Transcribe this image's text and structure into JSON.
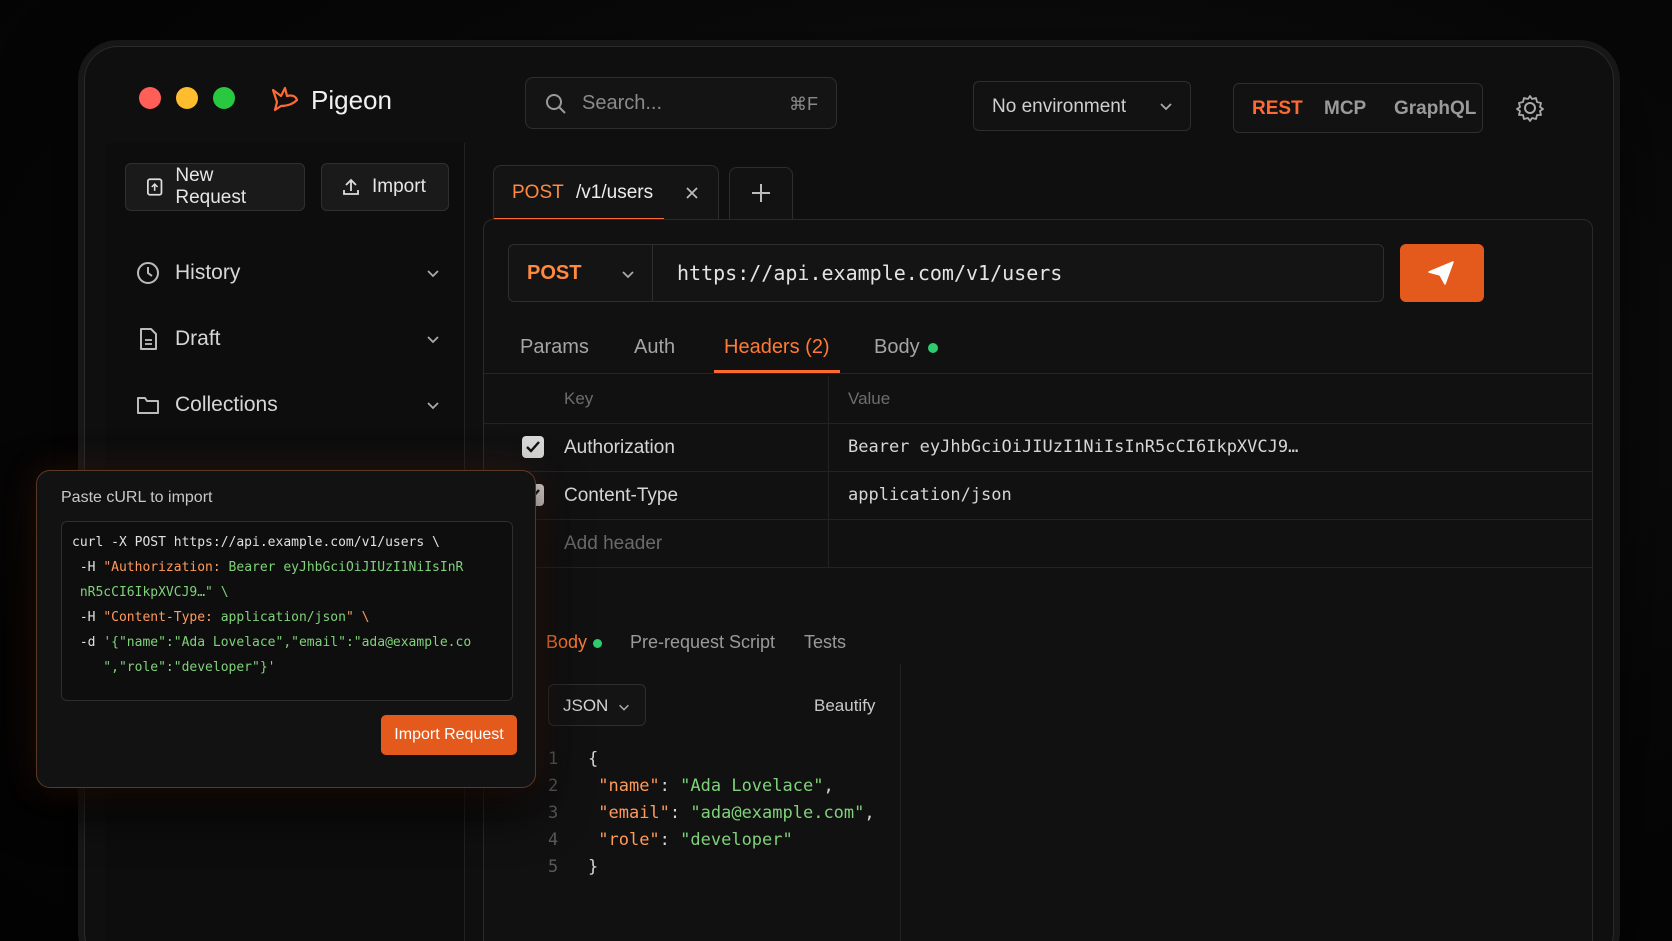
{
  "app": {
    "title": "Pigeon"
  },
  "search": {
    "placeholder": "Search...",
    "shortcut": "⌘F"
  },
  "environment": {
    "selected": "No environment"
  },
  "protocols": [
    "REST",
    "MCP",
    "GraphQL"
  ],
  "sidebar": {
    "new_request": "New Request",
    "import": "Import",
    "items": [
      {
        "label": "History",
        "icon": "clock-icon"
      },
      {
        "label": "Draft",
        "icon": "file-icon"
      },
      {
        "label": "Collections",
        "icon": "folder-icon"
      }
    ]
  },
  "request_tab": {
    "method": "POST",
    "path": "/v1/users"
  },
  "request": {
    "method": "POST",
    "url": "https://api.example.com/v1/users"
  },
  "subtabs": {
    "params": "Params",
    "auth": "Auth",
    "headers": "Headers (2)",
    "body": "Body"
  },
  "headers": {
    "col_key": "Key",
    "col_value": "Value",
    "rows": [
      {
        "key": "Authorization",
        "value": "Bearer eyJhbGciOiJIUzI1NiIsInR5cCI6IkpXVCJ9…",
        "checked": true
      },
      {
        "key": "Content-Type",
        "value": "application/json",
        "checked": true
      }
    ],
    "add_placeholder": "Add header"
  },
  "body_tabs": {
    "body": "Body",
    "pre": "Pre-request Script",
    "tests": "Tests"
  },
  "body": {
    "format": "JSON",
    "beautify": "Beautify",
    "lines": [
      "1",
      "2",
      "3",
      "4",
      "5"
    ],
    "fields": [
      {
        "key": "\"name\"",
        "value": "\"Ada Lovelace\""
      },
      {
        "key": "\"email\"",
        "value": "\"ada@example.com\""
      },
      {
        "key": "\"role\"",
        "value": "\"developer\""
      }
    ]
  },
  "curl_popup": {
    "title": "Paste cURL to import",
    "line1": "curl -X POST https://api.example.com/v1/users \\",
    "line2a": " -H ",
    "line2b": "\"Authorization: ",
    "line2c": "Bearer eyJhbGciOiJIUzI1NiIsInR",
    "line3": " nR5cCI6IkpXVCJ9…\" \\",
    "line4a": " -H ",
    "line4b": "\"Content-Type: ",
    "line4c": "application/json",
    "line4d": "\" \\",
    "line5a": " -d ",
    "line5b": "'{\"name\":\"Ada Lovelace\",\"email\":\"ada@example.co",
    "line6": "    \",\"role\":\"developer\"}'",
    "button": "Import Request"
  },
  "colors": {
    "accent": "#e35a1c",
    "active_text": "#ff7a35",
    "live_dot": "#2ecc71"
  }
}
